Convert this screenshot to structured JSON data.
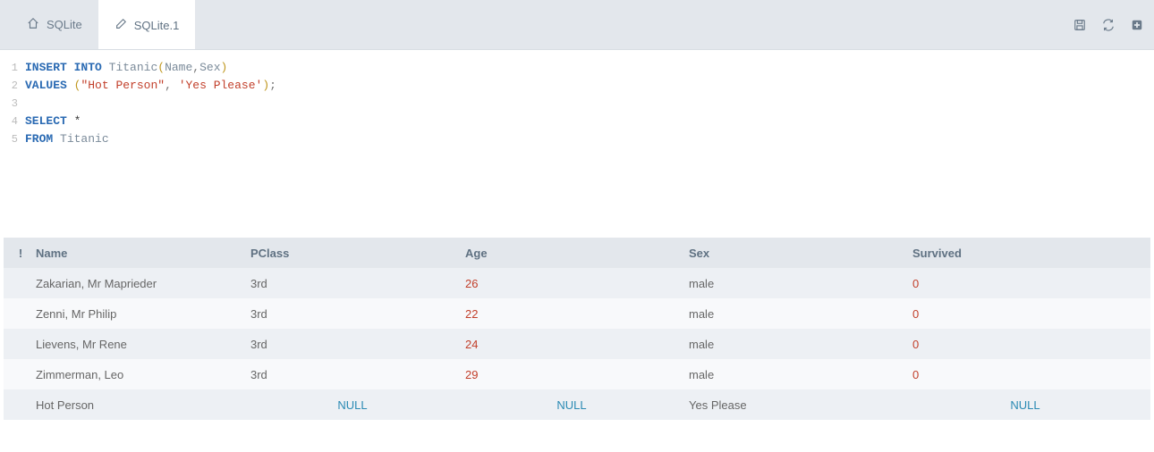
{
  "tabs": [
    {
      "label": "SQLite",
      "icon": "home-icon",
      "active": false
    },
    {
      "label": "SQLite.1",
      "icon": "edit-icon",
      "active": true
    }
  ],
  "toolbar": {
    "save": "save-icon",
    "refresh": "refresh-icon",
    "new": "plus-square-icon"
  },
  "editor": {
    "lines": [
      {
        "n": "1",
        "tokens": [
          {
            "t": "INSERT",
            "c": "kw"
          },
          {
            "t": " ",
            "c": ""
          },
          {
            "t": "INTO",
            "c": "kw"
          },
          {
            "t": " ",
            "c": ""
          },
          {
            "t": "Titanic",
            "c": "id"
          },
          {
            "t": "(",
            "c": "paren"
          },
          {
            "t": "Name",
            "c": "id"
          },
          {
            "t": ",",
            "c": "pun"
          },
          {
            "t": "Sex",
            "c": "id"
          },
          {
            "t": ")",
            "c": "paren"
          }
        ]
      },
      {
        "n": "2",
        "tokens": [
          {
            "t": "VALUES",
            "c": "kw"
          },
          {
            "t": " ",
            "c": ""
          },
          {
            "t": "(",
            "c": "paren"
          },
          {
            "t": "\"Hot Person\"",
            "c": "str"
          },
          {
            "t": ",",
            "c": "pun"
          },
          {
            "t": " ",
            "c": ""
          },
          {
            "t": "'Yes Please'",
            "c": "str"
          },
          {
            "t": ")",
            "c": "paren"
          },
          {
            "t": ";",
            "c": "pun"
          }
        ]
      },
      {
        "n": "3",
        "tokens": []
      },
      {
        "n": "4",
        "tokens": [
          {
            "t": "SELECT",
            "c": "kw"
          },
          {
            "t": " ",
            "c": ""
          },
          {
            "t": "*",
            "c": "star"
          }
        ]
      },
      {
        "n": "5",
        "tokens": [
          {
            "t": "FROM",
            "c": "kw"
          },
          {
            "t": " ",
            "c": ""
          },
          {
            "t": "Titanic",
            "c": "id"
          }
        ]
      }
    ]
  },
  "results": {
    "headers": {
      "bang": "!",
      "name": "Name",
      "pclass": "PClass",
      "age": "Age",
      "sex": "Sex",
      "survived": "Survived"
    },
    "null_text": "NULL",
    "rows": [
      {
        "name": "Zakarian, Mr Maprieder",
        "pclass": "3rd",
        "age": "26",
        "sex": "male",
        "survived": "0",
        "age_null": false,
        "pclass_null": false,
        "surv_null": false
      },
      {
        "name": "Zenni, Mr Philip",
        "pclass": "3rd",
        "age": "22",
        "sex": "male",
        "survived": "0",
        "age_null": false,
        "pclass_null": false,
        "surv_null": false
      },
      {
        "name": "Lievens, Mr Rene",
        "pclass": "3rd",
        "age": "24",
        "sex": "male",
        "survived": "0",
        "age_null": false,
        "pclass_null": false,
        "surv_null": false
      },
      {
        "name": "Zimmerman, Leo",
        "pclass": "3rd",
        "age": "29",
        "sex": "male",
        "survived": "0",
        "age_null": false,
        "pclass_null": false,
        "surv_null": false
      },
      {
        "name": "Hot Person",
        "pclass": "",
        "age": "",
        "sex": "Yes Please",
        "survived": "",
        "age_null": true,
        "pclass_null": true,
        "surv_null": true
      }
    ]
  }
}
